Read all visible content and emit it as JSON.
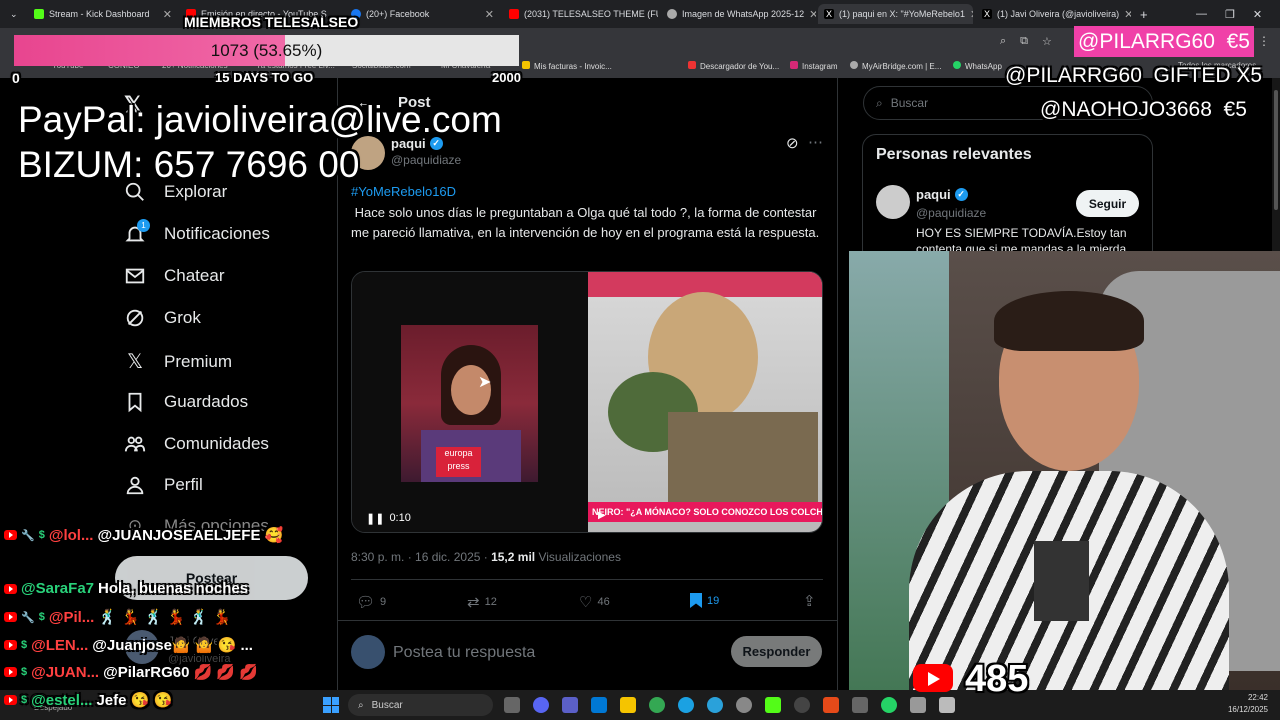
{
  "browser": {
    "tabs": [
      {
        "label": "Stream - Kick Dashboard",
        "color": "#53fc18"
      },
      {
        "label": "Emisión en directo - YouTube S",
        "color": "#ff0000"
      },
      {
        "label": "(20+) Facebook",
        "color": "#1877f2"
      },
      {
        "label": "(2031) TELESALSEO THEME (FU",
        "color": "#ff0000"
      },
      {
        "label": "Imagen de WhatsApp 2025-12",
        "color": "#aaaaaa"
      },
      {
        "label": "(1) paqui en X: \"#YoMeRebelo1",
        "color": "#ffffff"
      },
      {
        "label": "(1) Javi Oliveira (@javioliveira)",
        "color": "#ffffff"
      }
    ],
    "new_tab": "+",
    "bookmarks": [
      "YouTube",
      "CONIEO",
      "20+ Notificaciones",
      "Ya estamos Free Liv...",
      "Socialblade.com",
      "Mi Chavalería",
      "Mis facturas - Invoic...",
      "Descargador de You...",
      "Instagram",
      "MyAirBridge.com | E...",
      "WhatsApp",
      "(9) TikTok de Javi",
      "Todos los marcadores"
    ]
  },
  "overlay": {
    "goal_title": "MIEMBROS TELESALSEO",
    "goal_value": "1073 (53.65%)",
    "goal_fraction": 0.5365,
    "goal_min": "0",
    "goal_max": "2000",
    "goal_days": "15 DAYS TO GO",
    "paypal": "PayPal: javioliveira@live.com",
    "bizum": "BIZUM: 657 7696 00",
    "top_donor": "@PILARRG60  €5",
    "gifted": "@PILARRG60  GIFTED X5",
    "donor2": "@NAOHOJO3668  €5",
    "viewers": "485",
    "chat": [
      {
        "user": "@lol...",
        "message": "@JUANJOSEAELJEFE 🥰",
        "color": "#ff4040"
      },
      {
        "user": "@SaraFa7",
        "message": "Hola, buenas noches",
        "color": "#29d27a"
      },
      {
        "user": "@Pil...",
        "message": "🕺 💃 🕺 💃 🕺 💃",
        "color": "#ff4040"
      },
      {
        "user": "@LEN...",
        "message": "@Juanjose🤷 🤷 😘 ...",
        "color": "#ff4040"
      },
      {
        "user": "@JUAN...",
        "message": "@PilarRG60 💋 💋 💋",
        "color": "#ff4040"
      },
      {
        "user": "@estel...",
        "message": "Jefe 😘 😘",
        "color": "#29d27a"
      }
    ],
    "chat_fragment": "Hola, buenas noches",
    "avatar_label": "Javi Oliveira",
    "avatar_handle": "@javioliveira"
  },
  "x_nav": {
    "items": [
      "Explorar",
      "Notificaciones",
      "Chatear",
      "Grok",
      "Premium",
      "Guardados",
      "Comunidades",
      "Perfil",
      "Más opciones"
    ],
    "notif_count": "1",
    "post_button": "Postear"
  },
  "post": {
    "header": "Post",
    "author": "paqui",
    "handle": "@paquidiaze",
    "hashtag": "#YoMeRebelo16D",
    "text": " Hace solo unos días le preguntaban a Olga qué tal todo ?, la forma de contestar me pareció llamativa, en la intervención de hoy en el programa está la respuesta.",
    "video_time": "0:10",
    "video_brand": "europa press",
    "right_caption": "NEIRO: \"¿A MÓNACO? SOLO CONOZCO LOS COLCHON",
    "timestamp": "8:30 p. m. · 16 dic. 2025 · ",
    "views_count": "15,2 mil",
    "views_label": "Visualizaciones",
    "replies": "9",
    "reposts": "12",
    "likes": "46",
    "bookmarks": "19",
    "reply_placeholder": "Postea tu respuesta",
    "reply_button": "Responder"
  },
  "right": {
    "search_placeholder": "Buscar",
    "relevant_title": "Personas relevantes",
    "person_name": "paqui",
    "person_handle": "@paquidiaze",
    "follow": "Seguir",
    "bio": "HOY ES SIEMPRE TODAVÍA.Estoy tan contenta que si me mandas a la mierda"
  },
  "taskbar": {
    "weather": "Despejado",
    "search": "Buscar",
    "time": "22:42",
    "date": "16/12/2025"
  }
}
